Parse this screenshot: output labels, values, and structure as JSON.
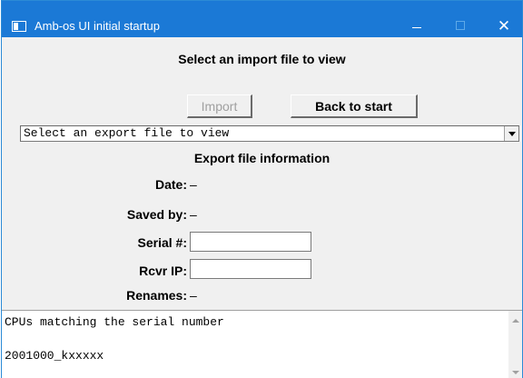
{
  "window": {
    "title": "Amb-os UI initial startup",
    "accent_color": "#1b79d6",
    "controls": {
      "minimize_icon": "minimize-icon",
      "maximize_icon": "maximize-icon",
      "close_icon": "close-icon",
      "close_glyph": "✕"
    }
  },
  "import_section": {
    "heading": "Select an import file to view",
    "import_label": "Import",
    "back_label": "Back to start"
  },
  "export_select": {
    "selected": "Select an export file to view",
    "icon": "dropdown-arrow-icon"
  },
  "export_info": {
    "heading": "Export file information",
    "date_label": "Date:",
    "date_value": "–",
    "saved_by_label": "Saved by:",
    "saved_by_value": "–",
    "serial_label": "Serial #:",
    "serial_value": "",
    "rcvr_ip_label": "Rcvr IP:",
    "rcvr_ip_value": "",
    "renames_label": "Renames:",
    "renames_value": "–"
  },
  "output": {
    "lines": [
      "CPUs matching the serial number",
      "2001000_kxxxxx"
    ]
  }
}
